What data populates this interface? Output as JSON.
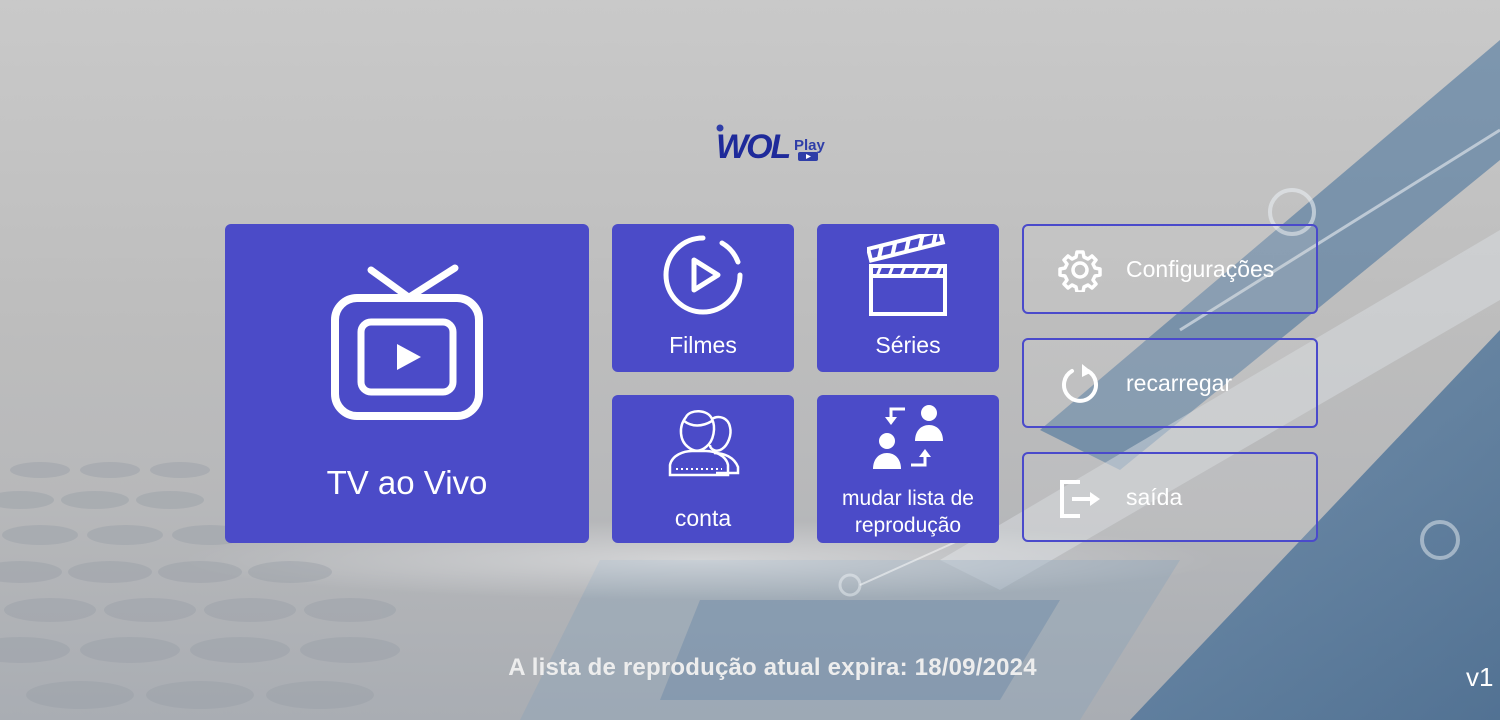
{
  "colors": {
    "tile_bg": "#4b4bc8",
    "button_border": "#4a4acb",
    "logo_primary": "#1e2a9a",
    "logo_secondary": "#2f3ea8"
  },
  "logo": {
    "main": "WOL",
    "sub": "Play"
  },
  "tiles": {
    "live_tv": {
      "label": "TV ao Vivo",
      "icon": "tv-play-icon"
    },
    "movies": {
      "label": "Filmes",
      "icon": "play-circle-icon"
    },
    "series": {
      "label": "Séries",
      "icon": "clapperboard-icon"
    },
    "account": {
      "label": "conta",
      "icon": "users-icon"
    },
    "change_playlist": {
      "line1": "mudar lista de",
      "line2": "reprodução",
      "icon": "switch-users-icon"
    }
  },
  "side_buttons": {
    "settings": {
      "label": "Configurações",
      "icon": "gear-icon"
    },
    "reload": {
      "label": "recarregar",
      "icon": "reload-icon"
    },
    "exit": {
      "label": "saída",
      "icon": "exit-icon"
    }
  },
  "footer": {
    "expiry": "A lista de reprodução atual expira: 18/09/2024",
    "version": "v1"
  }
}
